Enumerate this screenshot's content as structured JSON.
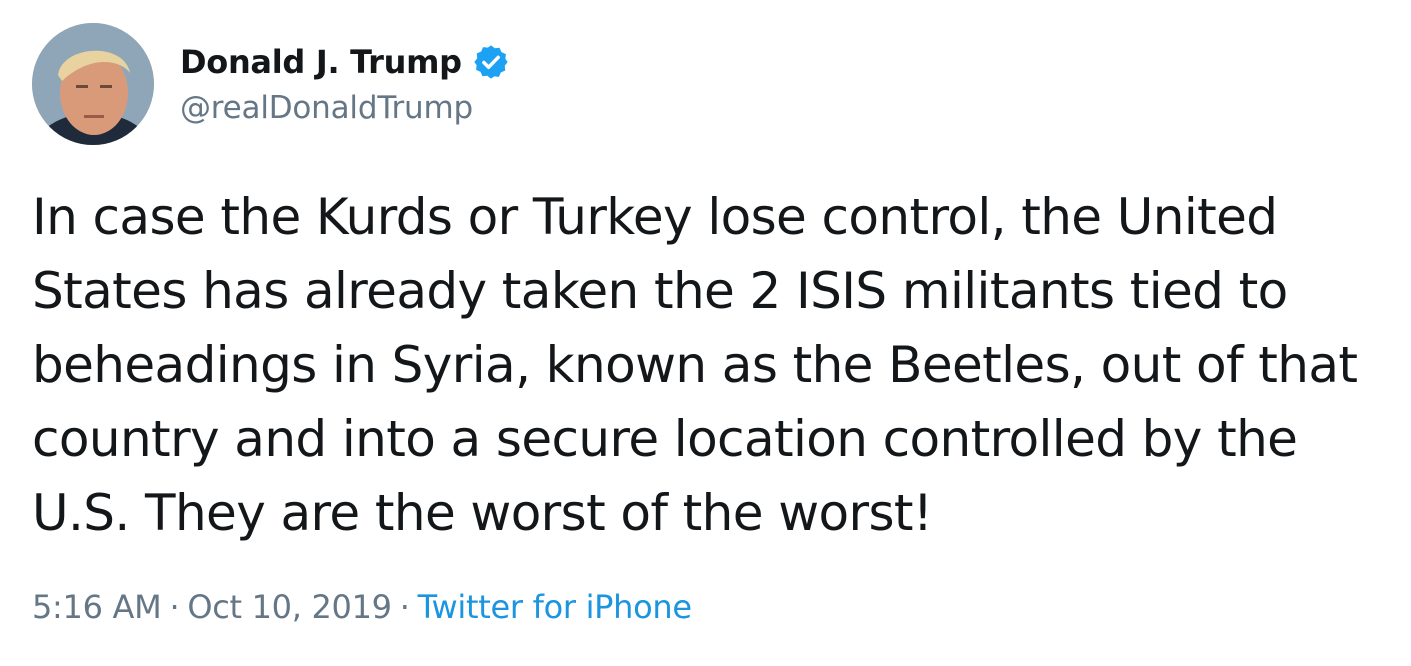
{
  "user": {
    "display_name": "Donald J. Trump",
    "handle": "@realDonaldTrump",
    "verified_icon": "verified-badge-icon",
    "verified_color": "#1da1f2"
  },
  "tweet": {
    "lines": [
      "In case the Kurds or Turkey lose control, the United",
      "States has already taken the 2 ISIS militants tied to",
      "beheadings in Syria, known as the Beetles, out of that",
      "country and into a secure location controlled by the",
      "U.S. They are the worst of the worst!"
    ]
  },
  "meta": {
    "time": "5:16 AM",
    "separator": "·",
    "date": "Oct 10, 2019",
    "source": "Twitter for iPhone",
    "source_color": "#1b95e0"
  }
}
